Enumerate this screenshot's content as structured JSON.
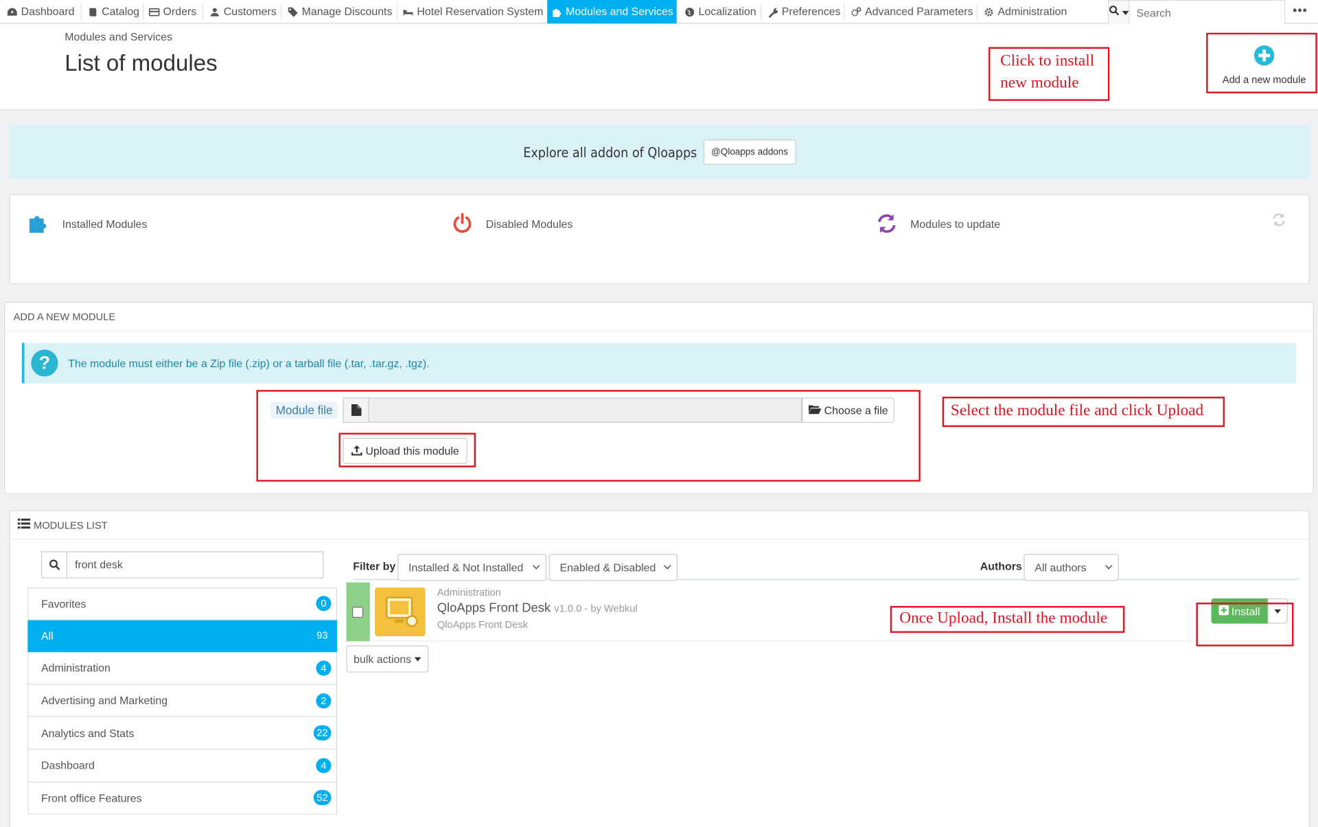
{
  "nav": {
    "items": [
      {
        "label": "Dashboard",
        "icon": "dashboard-icon"
      },
      {
        "label": "Catalog",
        "icon": "book-icon"
      },
      {
        "label": "Orders",
        "icon": "credit-card-icon"
      },
      {
        "label": "Customers",
        "icon": "users-icon"
      },
      {
        "label": "Manage Discounts",
        "icon": "tag-icon"
      },
      {
        "label": "Hotel Reservation System",
        "icon": "bed-icon"
      },
      {
        "label": "Modules and Services",
        "icon": "puzzle-icon",
        "active": true
      },
      {
        "label": "Localization",
        "icon": "globe-icon"
      },
      {
        "label": "Preferences",
        "icon": "wrench-icon"
      },
      {
        "label": "Advanced Parameters",
        "icon": "cogs-icon"
      },
      {
        "label": "Administration",
        "icon": "gear-icon"
      }
    ],
    "search_placeholder": "Search",
    "more": "•••"
  },
  "header": {
    "breadcrumb": "Modules and Services",
    "title": "List of modules",
    "add_module_label": "Add a new module"
  },
  "annotations": {
    "click_install": "Click to install new module",
    "select_upload": "Select the module file and click Upload",
    "once_upload": "Once Upload, Install the module"
  },
  "explore": {
    "text": "Explore all addon of Qloapps",
    "button": "@Qloapps addons"
  },
  "stats": {
    "installed": "Installed Modules",
    "disabled": "Disabled Modules",
    "to_update": "Modules to update"
  },
  "add_new_module": {
    "heading": "ADD A NEW MODULE",
    "info": "The module must either be a Zip file (.zip) or a tarball file (.tar, .tar.gz, .tgz).",
    "file_label": "Module file",
    "choose": "Choose a file",
    "upload": "Upload this module"
  },
  "modules_list": {
    "heading": "MODULES LIST",
    "search_value": "front desk",
    "categories": [
      {
        "label": "Favorites",
        "count": "0"
      },
      {
        "label": "All",
        "count": "93",
        "active": true
      },
      {
        "label": "Administration",
        "count": "4"
      },
      {
        "label": "Advertising and Marketing",
        "count": "2"
      },
      {
        "label": "Analytics and Stats",
        "count": "22"
      },
      {
        "label": "Dashboard",
        "count": "4"
      },
      {
        "label": "Front office Features",
        "count": "52"
      }
    ],
    "filter_by": "Filter by",
    "filter_install": "Installed & Not Installed",
    "filter_enabled": "Enabled & Disabled",
    "authors_label": "Authors",
    "authors_value": "All authors",
    "module": {
      "category": "Administration",
      "name": "QloApps Front Desk",
      "version": "v1.0.0 - by Webkul",
      "description": "QloApps Front Desk",
      "install": "Install"
    },
    "bulk": "bulk actions"
  },
  "colors": {
    "accent": "#00aff0",
    "annotation": "#e0141e",
    "install": "#5cb85c",
    "info_bg": "#d9f1f7"
  }
}
